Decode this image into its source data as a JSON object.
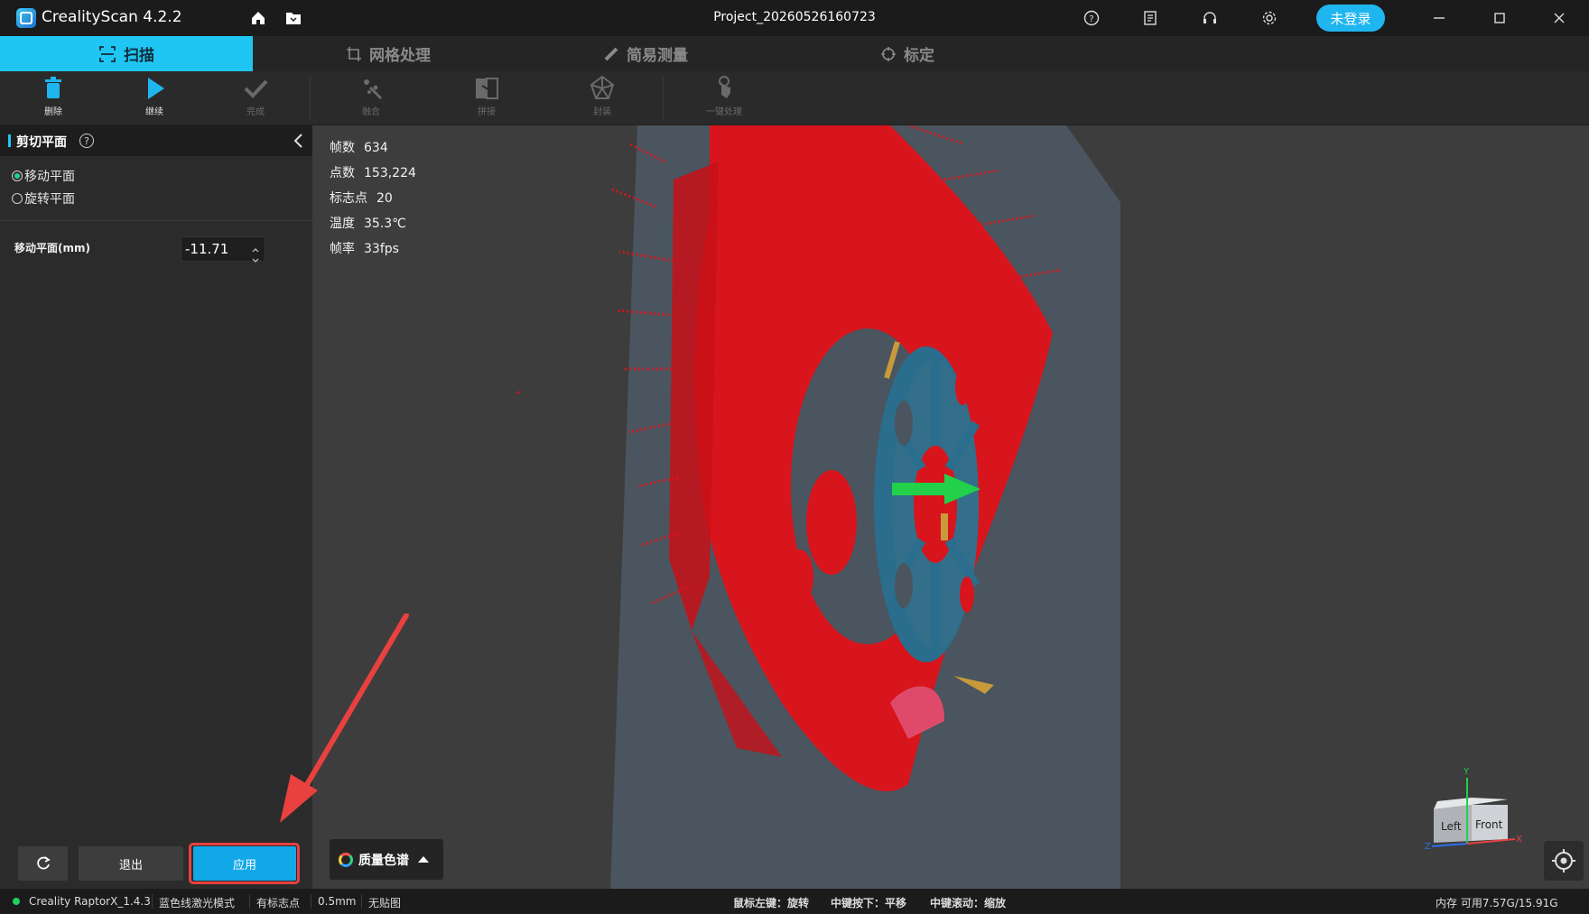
{
  "app": {
    "title": "CrealityScan 4.2.2",
    "project": "Project_20260526160723",
    "login_label": "未登录",
    "accent_color": "#1fc6f3"
  },
  "tabs": [
    {
      "label": "扫描",
      "icon": "scan-frame-icon",
      "active": true
    },
    {
      "label": "网格处理",
      "icon": "crop-icon",
      "active": false
    },
    {
      "label": "简易测量",
      "icon": "ruler-icon",
      "active": false
    },
    {
      "label": "标定",
      "icon": "target-icon",
      "active": false
    }
  ],
  "toolbar": {
    "delete": "删除",
    "continue": "继续",
    "done": "完成",
    "fuse": "融合",
    "stitch": "拼接",
    "mesh": "封装",
    "one_click": "一键处理"
  },
  "panel": {
    "title": "剪切平面",
    "option_move": "移动平面",
    "option_rotate": "旋转平面",
    "selected_option": "移动平面",
    "field_label": "移动平面(mm)",
    "field_value": "-11.71",
    "exit": "退出",
    "apply": "应用"
  },
  "stats": [
    {
      "label": "帧数",
      "value": "634"
    },
    {
      "label": "点数",
      "value": "153,224"
    },
    {
      "label": "标志点",
      "value": "20"
    },
    {
      "label": "温度",
      "value": "35.3℃"
    },
    {
      "label": "帧率",
      "value": "33fps"
    }
  ],
  "viewport": {
    "quality_label": "质量色谱",
    "cube_left": "Left",
    "cube_front": "Front",
    "axis_x": "X",
    "axis_y": "Y",
    "axis_z": "Z"
  },
  "statusbar": {
    "device": "Creality RaptorX_1.4.3",
    "mode": "蓝色线激光模式",
    "markers": "有标志点",
    "resolution": "0.5mm",
    "texture": "无贴图",
    "hint_left": "鼠标左键：旋转",
    "hint_middle": "中键按下：平移",
    "hint_scroll": "中键滚动：缩放",
    "memory": "内存 可用7.57G/15.91G"
  }
}
